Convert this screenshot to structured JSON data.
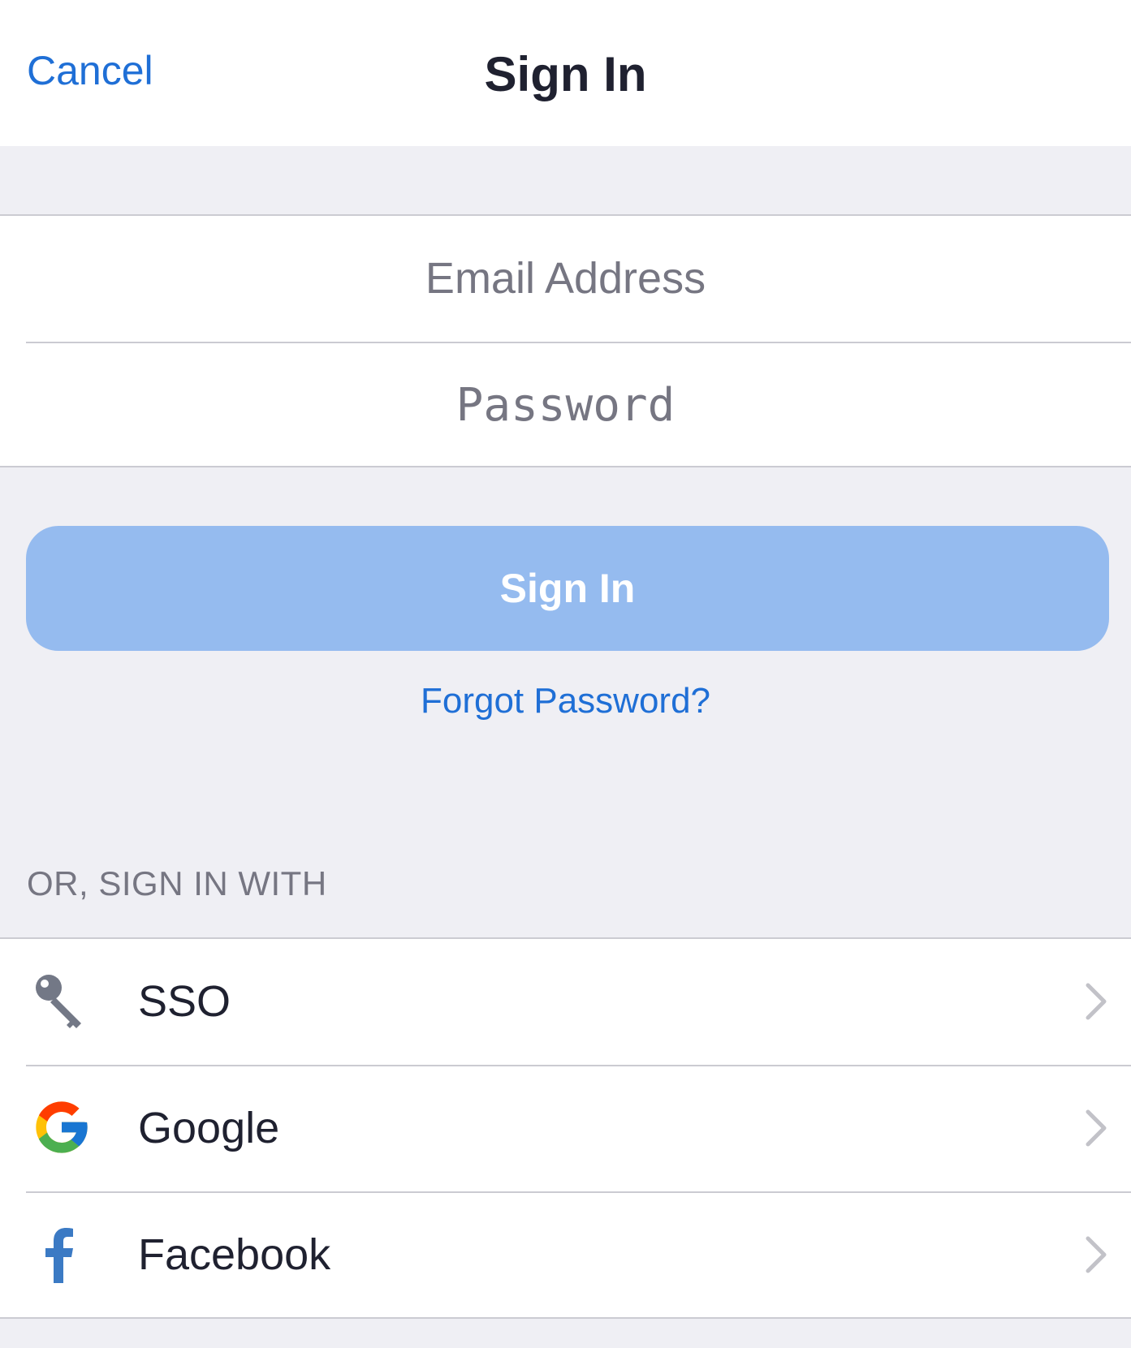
{
  "header": {
    "cancel_label": "Cancel",
    "title": "Sign In"
  },
  "form": {
    "email_placeholder": "Email Address",
    "password_placeholder": "Password",
    "signin_label": "Sign In",
    "forgot_label": "Forgot Password?"
  },
  "alt_signin": {
    "section_label": "OR, SIGN IN WITH",
    "providers": [
      {
        "label": "SSO",
        "icon": "key-icon"
      },
      {
        "label": "Google",
        "icon": "google-icon"
      },
      {
        "label": "Facebook",
        "icon": "facebook-icon"
      }
    ]
  },
  "colors": {
    "accent": "#1f6fd6",
    "button_disabled": "#95bbef",
    "background": "#efeff4",
    "separator": "#cbcbd2",
    "facebook": "#3b7ac4"
  }
}
